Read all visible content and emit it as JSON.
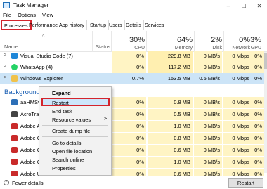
{
  "window": {
    "title": "Task Manager",
    "controls": {
      "minimize": "–",
      "maximize": "☐",
      "close": "✕"
    }
  },
  "menu": [
    "File",
    "Options",
    "View"
  ],
  "tabs": [
    "Processes",
    "Performance",
    "App history",
    "Startup",
    "Users",
    "Details",
    "Services"
  ],
  "active_tab": "Processes",
  "columns": {
    "name": "Name",
    "status": "Status",
    "cpu": {
      "pct": "30%",
      "label": "CPU"
    },
    "memory": {
      "pct": "64%",
      "label": "Memory"
    },
    "disk": {
      "pct": "2%",
      "label": "Disk"
    },
    "network": {
      "pct": "0%",
      "label": "Network"
    },
    "gpu": {
      "pct": "3%",
      "label": "GPU"
    }
  },
  "processes": [
    {
      "expand": ">",
      "name": "Visual Studio Code (7)",
      "cpu": "0%",
      "memory": "229.8 MB",
      "disk": "0 MB/s",
      "network": "0 Mbps",
      "gpu": "0%",
      "icon_color": "#1f87d8"
    },
    {
      "expand": ">",
      "name": "WhatsApp (4)",
      "cpu": "0%",
      "memory": "117.2 MB",
      "disk": "0 MB/s",
      "network": "0 Mbps",
      "gpu": "0%",
      "icon_color": "#25d366"
    },
    {
      "expand": ">",
      "name": "Windows Explorer",
      "cpu": "0.7%",
      "memory": "153.5 MB",
      "disk": "0.5 MB/s",
      "network": "0 Mbps",
      "gpu": "0%",
      "icon_color": "#f0c24b",
      "selected": true
    }
  ],
  "section_label": "Background",
  "background_processes": [
    {
      "name": "aaHMSv",
      "cpu": "0%",
      "memory": "0.8 MB",
      "disk": "0 MB/s",
      "network": "0 Mbps",
      "gpu": "0%",
      "icon_color": "#2c6fb7"
    },
    {
      "name": "AcroTray",
      "cpu": "0%",
      "memory": "0.5 MB",
      "disk": "0 MB/s",
      "network": "0 Mbps",
      "gpu": "0%",
      "icon_color": "#444"
    },
    {
      "name": "Adobe A",
      "cpu": "0%",
      "memory": "1.0 MB",
      "disk": "0 MB/s",
      "network": "0 Mbps",
      "gpu": "0%",
      "icon_color": "#c92a2a"
    },
    {
      "name": "Adobe C",
      "cpu": "0%",
      "memory": "0.8 MB",
      "disk": "0 MB/s",
      "network": "0 Mbps",
      "gpu": "0%",
      "icon_color": "#c92a2a"
    },
    {
      "name": "Adobe C",
      "cpu": "0%",
      "memory": "0.6 MB",
      "disk": "0 MB/s",
      "network": "0 Mbps",
      "gpu": "0%",
      "icon_color": "#c92a2a"
    },
    {
      "name": "Adobe G",
      "cpu": "0%",
      "memory": "1.0 MB",
      "disk": "0 MB/s",
      "network": "0 Mbps",
      "gpu": "0%",
      "icon_color": "#c92a2a"
    },
    {
      "name": "Adobe U",
      "cpu": "0%",
      "memory": "0.6 MB",
      "disk": "0 MB/s",
      "network": "0 Mbps",
      "gpu": "0%",
      "icon_color": "#c92a2a"
    }
  ],
  "context_menu": {
    "items": [
      "Expand",
      "Restart",
      "End task",
      "Resource values",
      "Create dump file",
      "Go to details",
      "Open file location",
      "Search online",
      "Properties"
    ],
    "submenu_arrow": ">",
    "highlighted": "Restart"
  },
  "footer": {
    "fewer_details": "Fewer details",
    "fewer_icon": "^",
    "action_button": "Restart"
  },
  "colors": {
    "highlight_red": "#d4242c",
    "selection_blue": "#cce4f7",
    "section_blue": "#1a5fb4",
    "heat_yellow": "#fff4c4"
  }
}
